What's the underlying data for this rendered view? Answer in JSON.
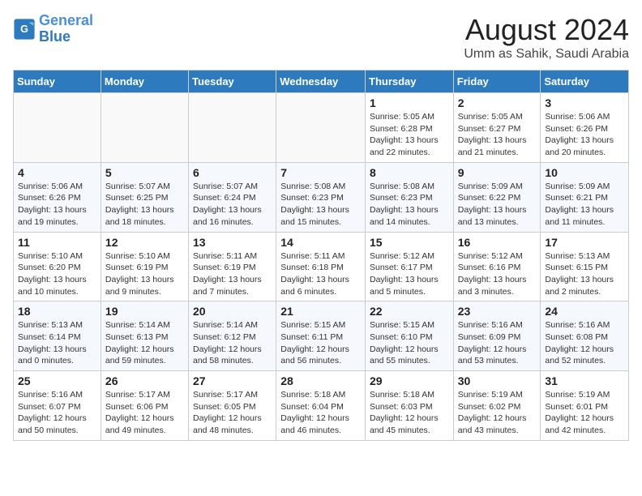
{
  "logo": {
    "general": "General",
    "blue": "Blue"
  },
  "title": "August 2024",
  "subtitle": "Umm as Sahik, Saudi Arabia",
  "days_of_week": [
    "Sunday",
    "Monday",
    "Tuesday",
    "Wednesday",
    "Thursday",
    "Friday",
    "Saturday"
  ],
  "weeks": [
    [
      {
        "day": "",
        "info": ""
      },
      {
        "day": "",
        "info": ""
      },
      {
        "day": "",
        "info": ""
      },
      {
        "day": "",
        "info": ""
      },
      {
        "day": "1",
        "info": "Sunrise: 5:05 AM\nSunset: 6:28 PM\nDaylight: 13 hours\nand 22 minutes."
      },
      {
        "day": "2",
        "info": "Sunrise: 5:05 AM\nSunset: 6:27 PM\nDaylight: 13 hours\nand 21 minutes."
      },
      {
        "day": "3",
        "info": "Sunrise: 5:06 AM\nSunset: 6:26 PM\nDaylight: 13 hours\nand 20 minutes."
      }
    ],
    [
      {
        "day": "4",
        "info": "Sunrise: 5:06 AM\nSunset: 6:26 PM\nDaylight: 13 hours\nand 19 minutes."
      },
      {
        "day": "5",
        "info": "Sunrise: 5:07 AM\nSunset: 6:25 PM\nDaylight: 13 hours\nand 18 minutes."
      },
      {
        "day": "6",
        "info": "Sunrise: 5:07 AM\nSunset: 6:24 PM\nDaylight: 13 hours\nand 16 minutes."
      },
      {
        "day": "7",
        "info": "Sunrise: 5:08 AM\nSunset: 6:23 PM\nDaylight: 13 hours\nand 15 minutes."
      },
      {
        "day": "8",
        "info": "Sunrise: 5:08 AM\nSunset: 6:23 PM\nDaylight: 13 hours\nand 14 minutes."
      },
      {
        "day": "9",
        "info": "Sunrise: 5:09 AM\nSunset: 6:22 PM\nDaylight: 13 hours\nand 13 minutes."
      },
      {
        "day": "10",
        "info": "Sunrise: 5:09 AM\nSunset: 6:21 PM\nDaylight: 13 hours\nand 11 minutes."
      }
    ],
    [
      {
        "day": "11",
        "info": "Sunrise: 5:10 AM\nSunset: 6:20 PM\nDaylight: 13 hours\nand 10 minutes."
      },
      {
        "day": "12",
        "info": "Sunrise: 5:10 AM\nSunset: 6:19 PM\nDaylight: 13 hours\nand 9 minutes."
      },
      {
        "day": "13",
        "info": "Sunrise: 5:11 AM\nSunset: 6:19 PM\nDaylight: 13 hours\nand 7 minutes."
      },
      {
        "day": "14",
        "info": "Sunrise: 5:11 AM\nSunset: 6:18 PM\nDaylight: 13 hours\nand 6 minutes."
      },
      {
        "day": "15",
        "info": "Sunrise: 5:12 AM\nSunset: 6:17 PM\nDaylight: 13 hours\nand 5 minutes."
      },
      {
        "day": "16",
        "info": "Sunrise: 5:12 AM\nSunset: 6:16 PM\nDaylight: 13 hours\nand 3 minutes."
      },
      {
        "day": "17",
        "info": "Sunrise: 5:13 AM\nSunset: 6:15 PM\nDaylight: 13 hours\nand 2 minutes."
      }
    ],
    [
      {
        "day": "18",
        "info": "Sunrise: 5:13 AM\nSunset: 6:14 PM\nDaylight: 13 hours\nand 0 minutes."
      },
      {
        "day": "19",
        "info": "Sunrise: 5:14 AM\nSunset: 6:13 PM\nDaylight: 12 hours\nand 59 minutes."
      },
      {
        "day": "20",
        "info": "Sunrise: 5:14 AM\nSunset: 6:12 PM\nDaylight: 12 hours\nand 58 minutes."
      },
      {
        "day": "21",
        "info": "Sunrise: 5:15 AM\nSunset: 6:11 PM\nDaylight: 12 hours\nand 56 minutes."
      },
      {
        "day": "22",
        "info": "Sunrise: 5:15 AM\nSunset: 6:10 PM\nDaylight: 12 hours\nand 55 minutes."
      },
      {
        "day": "23",
        "info": "Sunrise: 5:16 AM\nSunset: 6:09 PM\nDaylight: 12 hours\nand 53 minutes."
      },
      {
        "day": "24",
        "info": "Sunrise: 5:16 AM\nSunset: 6:08 PM\nDaylight: 12 hours\nand 52 minutes."
      }
    ],
    [
      {
        "day": "25",
        "info": "Sunrise: 5:16 AM\nSunset: 6:07 PM\nDaylight: 12 hours\nand 50 minutes."
      },
      {
        "day": "26",
        "info": "Sunrise: 5:17 AM\nSunset: 6:06 PM\nDaylight: 12 hours\nand 49 minutes."
      },
      {
        "day": "27",
        "info": "Sunrise: 5:17 AM\nSunset: 6:05 PM\nDaylight: 12 hours\nand 48 minutes."
      },
      {
        "day": "28",
        "info": "Sunrise: 5:18 AM\nSunset: 6:04 PM\nDaylight: 12 hours\nand 46 minutes."
      },
      {
        "day": "29",
        "info": "Sunrise: 5:18 AM\nSunset: 6:03 PM\nDaylight: 12 hours\nand 45 minutes."
      },
      {
        "day": "30",
        "info": "Sunrise: 5:19 AM\nSunset: 6:02 PM\nDaylight: 12 hours\nand 43 minutes."
      },
      {
        "day": "31",
        "info": "Sunrise: 5:19 AM\nSunset: 6:01 PM\nDaylight: 12 hours\nand 42 minutes."
      }
    ]
  ]
}
